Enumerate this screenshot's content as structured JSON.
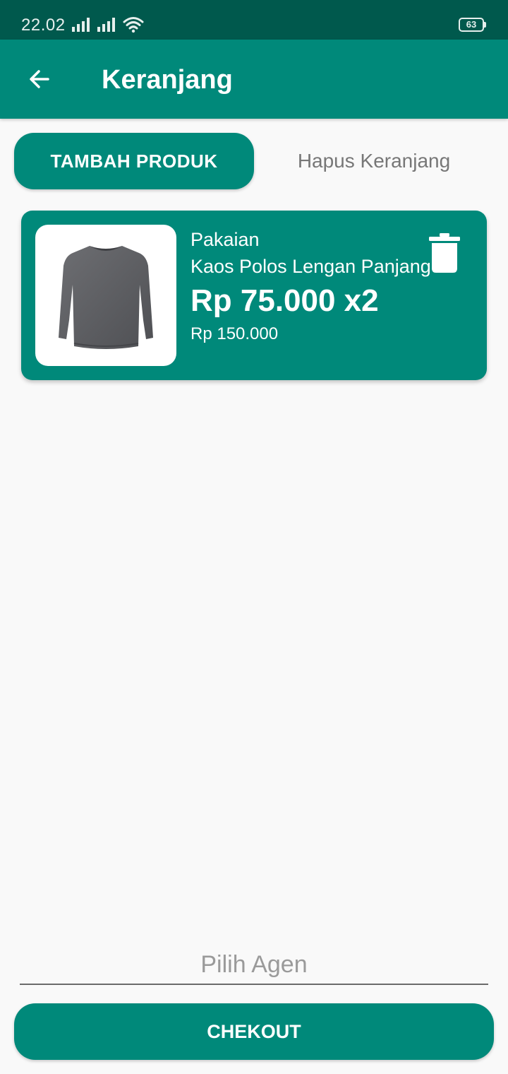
{
  "status_bar": {
    "time": "22.02",
    "battery": "63"
  },
  "app_bar": {
    "title": "Keranjang"
  },
  "actions": {
    "add_product_label": "TAMBAH PRODUK",
    "clear_cart_label": "Hapus Keranjang"
  },
  "cart": {
    "items": [
      {
        "category": "Pakaian",
        "name": "Kaos Polos Lengan Panjang",
        "price_qty": "Rp 75.000 x2",
        "subtotal": "Rp 150.000",
        "image_icon": "long-sleeve-shirt-icon"
      }
    ]
  },
  "agent_select": {
    "placeholder": "Pilih Agen"
  },
  "checkout": {
    "label": "CHEKOUT"
  },
  "colors": {
    "primary": "#00897a",
    "status_bar": "#00594d",
    "background": "#f9f9f9"
  }
}
